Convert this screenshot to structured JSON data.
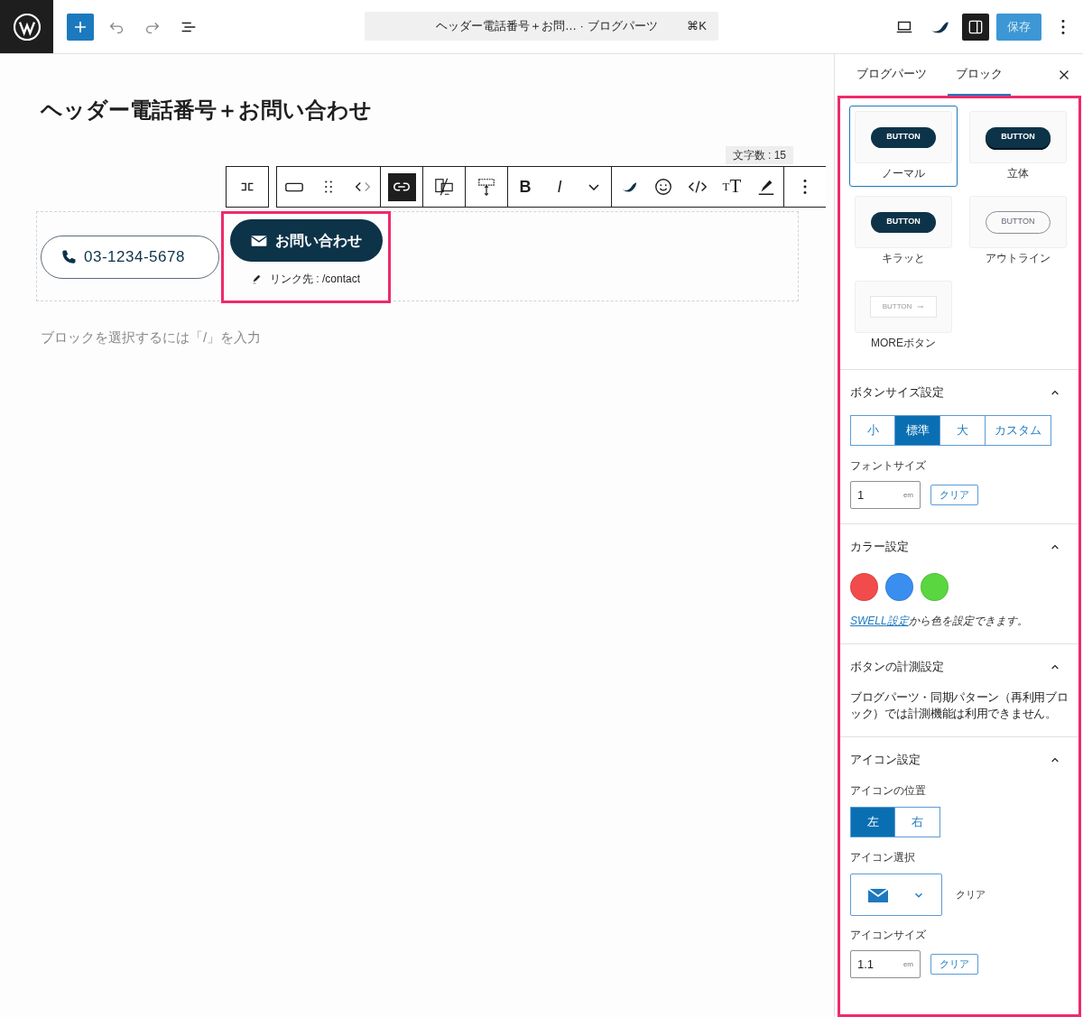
{
  "top_bar": {
    "document_title": "ヘッダー電話番号＋お問… · ブログパーツ",
    "shortcut": "⌘K",
    "save_label": "保存"
  },
  "editor": {
    "title": "ヘッダー電話番号＋お問い合わせ",
    "char_count": "文字数 : 15",
    "toolbar": [
      [
        {
          "kind": "align",
          "selected": false
        }
      ],
      [
        {
          "kind": "shape",
          "selected": false
        },
        {
          "kind": "drag",
          "selected": false
        },
        {
          "kind": "move",
          "selected": false
        }
      ],
      [
        {
          "kind": "link",
          "selected": true
        }
      ],
      [
        {
          "kind": "device",
          "selected": false
        }
      ],
      [
        {
          "kind": "height",
          "selected": false
        }
      ],
      [
        {
          "kind": "bold",
          "selected": false,
          "label": "B"
        },
        {
          "kind": "italic",
          "selected": false,
          "label": "I"
        },
        {
          "kind": "more",
          "selected": false
        }
      ],
      [
        {
          "kind": "swell",
          "selected": false
        },
        {
          "kind": "emoji",
          "selected": false
        },
        {
          "kind": "code",
          "selected": false
        },
        {
          "kind": "fontsize",
          "selected": false,
          "label": "TT"
        },
        {
          "kind": "highlight",
          "selected": false
        }
      ],
      [
        {
          "kind": "options",
          "selected": false
        }
      ]
    ],
    "phone_button": "03-1234-5678",
    "contact_button": "お問い合わせ",
    "link_hint": "リンク先 : /contact",
    "placeholder": "ブロックを選択するには「/」を入力"
  },
  "sidebar": {
    "tabs": [
      {
        "label": "ブログパーツ",
        "selected": false
      },
      {
        "label": "ブロック",
        "selected": true
      }
    ],
    "styles": [
      {
        "kind": "normal",
        "sample": "BUTTON",
        "label": "ノーマル",
        "selected": true
      },
      {
        "kind": "solid",
        "sample": "BUTTON",
        "label": "立体",
        "selected": false
      },
      {
        "kind": "shiny",
        "sample": "BUTTON",
        "label": "キラッと",
        "selected": false
      },
      {
        "kind": "outline",
        "sample": "BUTTON",
        "label": "アウトライン",
        "selected": false
      },
      {
        "kind": "more",
        "sample": "BUTTON",
        "label": "MOREボタン",
        "selected": false
      }
    ],
    "size_section": {
      "title": "ボタンサイズ設定",
      "expanded": true,
      "options": [
        {
          "label": "小",
          "selected": false
        },
        {
          "label": "標準",
          "selected": true
        },
        {
          "label": "大",
          "selected": false
        },
        {
          "label": "カスタム",
          "selected": false
        }
      ],
      "font_size_label": "フォントサイズ",
      "font_size": {
        "value": "1",
        "unit": "em"
      },
      "clear": "クリア"
    },
    "color_section": {
      "title": "カラー設定",
      "expanded": true,
      "colors": [
        {
          "color": "#f24b4b"
        },
        {
          "color": "#3a8ef0"
        },
        {
          "color": "#5ad640"
        }
      ],
      "note_link": "SWELL設定",
      "note_text": "から色を設定できます。"
    },
    "tracking_section": {
      "title": "ボタンの計測設定",
      "expanded": true,
      "body": "ブログパーツ・同期パターン（再利用ブロック）では計測機能は利用できません。"
    },
    "icon_section": {
      "title": "アイコン設定",
      "expanded": true,
      "position_label": "アイコンの位置",
      "positions": [
        {
          "label": "左",
          "selected": true
        },
        {
          "label": "右",
          "selected": false
        }
      ],
      "select_label": "アイコン選択",
      "select_clear": "クリア",
      "size_label": "アイコンサイズ",
      "icon_size": {
        "value": "1.1",
        "unit": "em"
      },
      "size_clear": "クリア"
    }
  }
}
